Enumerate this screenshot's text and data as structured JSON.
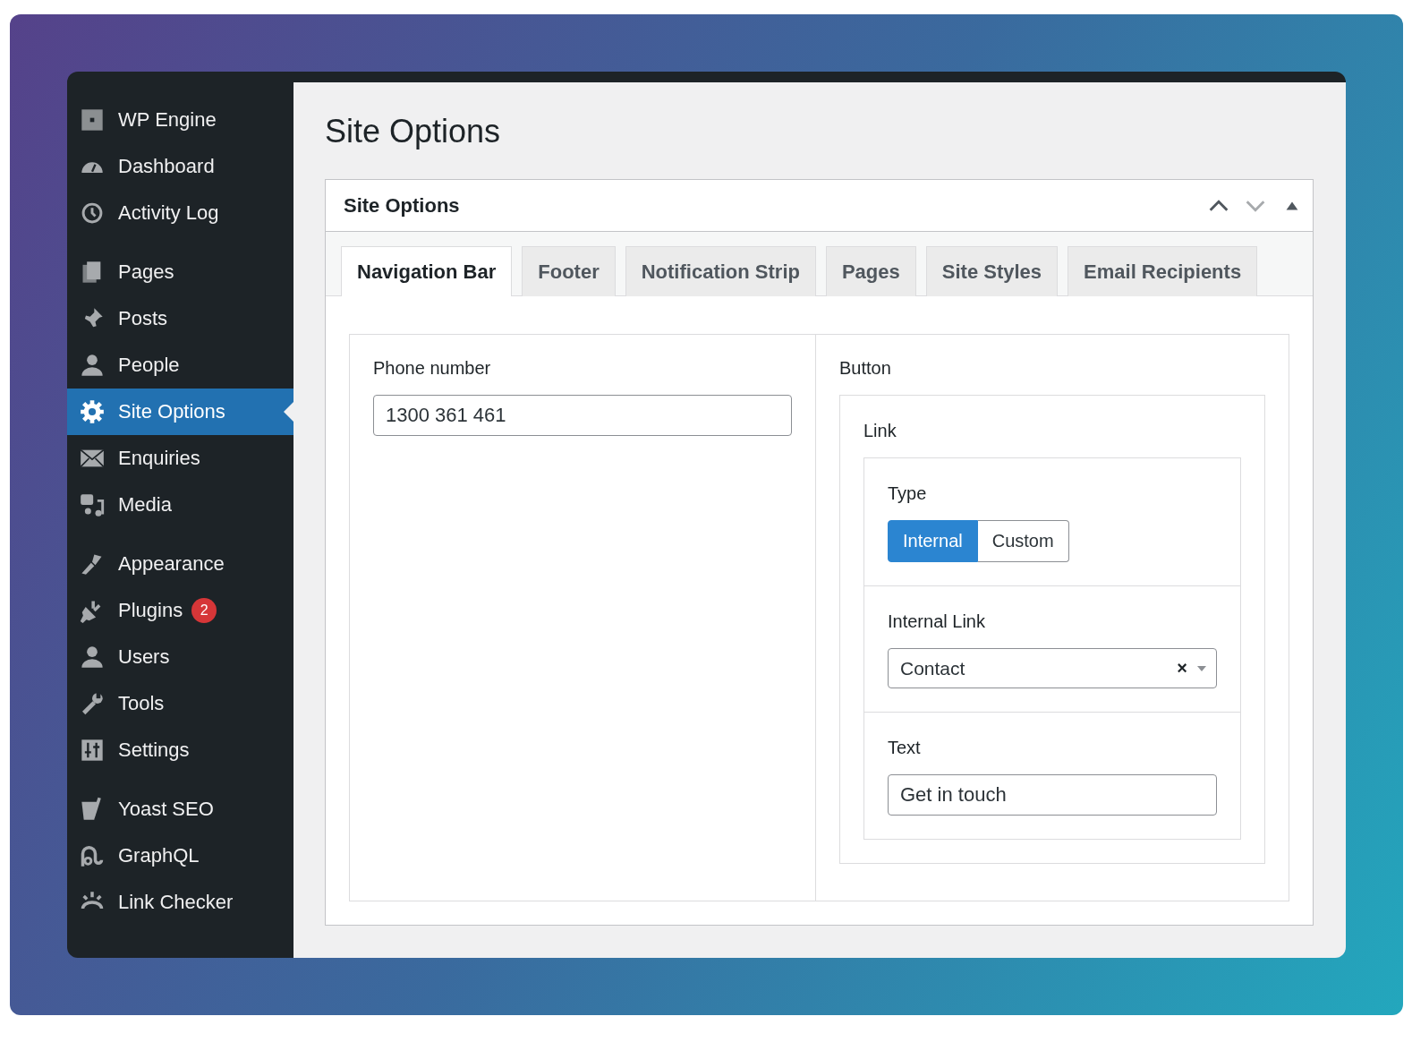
{
  "sidebar": {
    "groups": [
      {
        "items": [
          {
            "label": "WP Engine",
            "selected": false
          },
          {
            "label": "Dashboard",
            "selected": false
          },
          {
            "label": "Activity Log",
            "selected": false
          }
        ]
      },
      {
        "items": [
          {
            "label": "Pages",
            "selected": false
          },
          {
            "label": "Posts",
            "selected": false
          },
          {
            "label": "People",
            "selected": false
          },
          {
            "label": "Site Options",
            "selected": true
          },
          {
            "label": "Enquiries",
            "selected": false
          },
          {
            "label": "Media",
            "selected": false
          }
        ]
      },
      {
        "items": [
          {
            "label": "Appearance",
            "selected": false
          },
          {
            "label": "Plugins",
            "selected": false,
            "badge": "2"
          },
          {
            "label": "Users",
            "selected": false
          },
          {
            "label": "Tools",
            "selected": false
          },
          {
            "label": "Settings",
            "selected": false
          }
        ]
      },
      {
        "items": [
          {
            "label": "Yoast SEO",
            "selected": false
          },
          {
            "label": "GraphQL",
            "selected": false
          },
          {
            "label": "Link Checker",
            "selected": false
          }
        ]
      }
    ]
  },
  "page_title": "Site Options",
  "panel": {
    "title": "Site Options",
    "tabs": [
      {
        "label": "Navigation Bar",
        "selected": true
      },
      {
        "label": "Footer",
        "selected": false
      },
      {
        "label": "Notification Strip",
        "selected": false
      },
      {
        "label": "Pages",
        "selected": false
      },
      {
        "label": "Site Styles",
        "selected": false
      },
      {
        "label": "Email Recipients",
        "selected": false
      }
    ],
    "phone": {
      "label": "Phone number",
      "value": "1300 361 461"
    },
    "button": {
      "label": "Button",
      "link": {
        "label": "Link",
        "type": {
          "label": "Type",
          "options": [
            {
              "label": "Internal",
              "selected": true
            },
            {
              "label": "Custom",
              "selected": false
            }
          ]
        },
        "internal_link": {
          "label": "Internal Link",
          "value": "Contact",
          "clear": "×"
        },
        "text": {
          "label": "Text",
          "value": "Get in touch"
        }
      }
    }
  }
}
